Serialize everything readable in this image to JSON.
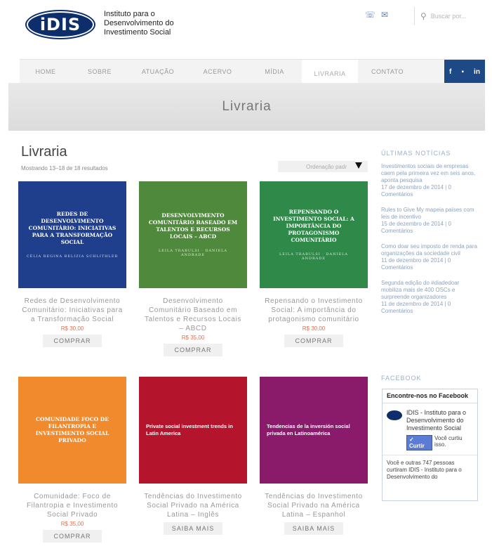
{
  "header": {
    "logo_text": "iDIS",
    "org_name": "Instituto para o Desenvolvimento do Investimento Social",
    "phone_icon": "phone-icon",
    "mail_icon": "mail-icon",
    "search_placeholder": "Buscar por..."
  },
  "nav": {
    "items": [
      {
        "label": "HOME"
      },
      {
        "label": "SOBRE"
      },
      {
        "label": "ATUAÇÃO"
      },
      {
        "label": "ACERVO"
      },
      {
        "label": "MÍDIA"
      },
      {
        "label": "LIVRARIA"
      },
      {
        "label": "CONTATO"
      }
    ],
    "social": [
      "f",
      "▪",
      "in"
    ]
  },
  "banner": {
    "title": "Livraria"
  },
  "main": {
    "title": "Livraria",
    "result_count": "Mostrando 13–18 de 18 resultados",
    "sort_label": "Ordenação padr"
  },
  "products": [
    {
      "name": "Redes de Desenvolvimento Comunitário: Iniciativas para a Transformação Social",
      "price": "R$ 30,00",
      "button": "COMPRAR",
      "cover_title": "Redes de Desenvolvimento Comunitário: Iniciativas para a Transformação Social",
      "cover_author": "CÉLIA REGINA BELIZIA SCHLITHLER",
      "cover_color": "#1f3f8c"
    },
    {
      "name": "Desenvolvimento Comunitário Baseado em Talentos e Recursos Locais – ABCD",
      "price": "R$ 35,00",
      "button": "COMPRAR",
      "cover_title": "Desenvolvimento Comunitário Baseado em Talentos e Recursos Locais – ABCD",
      "cover_author": "LEILA TRABULSI · DANIELA ANDRADE",
      "cover_color": "#4f8a3c"
    },
    {
      "name": "Repensando o Investimento Social: A importância do protagonismo comunitário",
      "price": "R$ 30,00",
      "button": "COMPRAR",
      "cover_title": "Repensando o Investimento Social: A importância do protagonismo comunitário",
      "cover_author": "LEILA TRABULSI · DANIELA ANDRADE",
      "cover_color": "#2f8a4a"
    },
    {
      "name": "Comunidade: Foco de Filantropia e Investimento Social Privado",
      "price": "R$ 35,00",
      "button": "COMPRAR",
      "cover_title": "Comunidade Foco de Filantropia e Investimento Social Privado",
      "cover_author": "",
      "cover_color": "#f08a2c"
    },
    {
      "name": "Tendências do Investimento Social Privado na América Latina – Inglês",
      "price": "",
      "button": "SAIBA MAIS",
      "cover_title": "Private social investment trends in Latin America",
      "cover_author": "",
      "cover_color": "#b4142c"
    },
    {
      "name": "Tendências do Investimento Social Privado na América Latina – Espanhol",
      "price": "",
      "button": "SAIBA MAIS",
      "cover_title": "Tendencias de la inversión social privada en Latinoamérica",
      "cover_author": "",
      "cover_color": "#8a1a6a"
    }
  ],
  "sidebar": {
    "news_heading": "ÚLTIMAS NOTÍCIAS",
    "news": [
      {
        "title": "Investimentos sociais de empresas caem pela primeira vez em seis anos, aponta pesquisa",
        "meta": "17 de dezembro de 2014 | 0 Comentários"
      },
      {
        "title": "Rules to Give My mapeia países com leis de incentivo",
        "meta": "15 de dezembro de 2014 | 0 Comentários"
      },
      {
        "title": "Como doar seu imposto de renda para organizações da sociedade civil",
        "meta": "11 de dezembro de 2014 | 0 Comentários"
      },
      {
        "title": "Segunda edição do #diadedoar mobiliza mais de 400 OSCs e surpreende organizadores",
        "meta": "11 de dezembro de 2014 | 0 Comentários"
      }
    ],
    "facebook_heading": "FACEBOOK",
    "facebook": {
      "title": "Encontre-nos no Facebook",
      "page_name": "IDIS - Instituto para o Desenvolvimento do Investimento Social",
      "like_button": "✓ Curtir",
      "like_text": "Você curtiu isso.",
      "count_text": "Você e outras 747 pessoas curtiram IDIS - Instituto para o Desenvolvimento do"
    }
  }
}
